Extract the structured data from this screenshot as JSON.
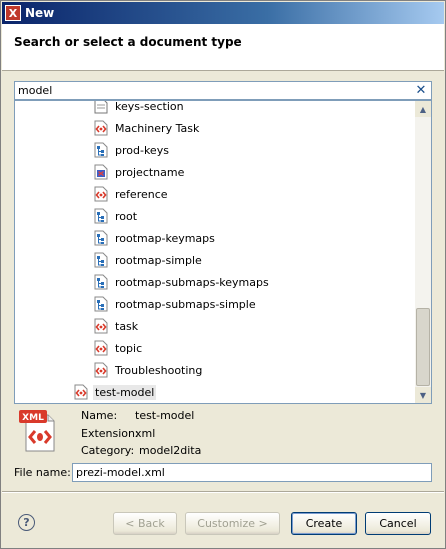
{
  "window": {
    "title": "New",
    "app_icon": "X"
  },
  "header": {
    "title": "Search or select a document type"
  },
  "search": {
    "value": "model"
  },
  "tree": {
    "items": [
      {
        "label": "keys-section",
        "icon": "document-icon"
      },
      {
        "label": "Machinery Task",
        "icon": "xml-red-icon"
      },
      {
        "label": "prod-keys",
        "icon": "map-icon"
      },
      {
        "label": "projectname",
        "icon": "project-icon"
      },
      {
        "label": "reference",
        "icon": "xml-red-icon"
      },
      {
        "label": "root",
        "icon": "map-icon"
      },
      {
        "label": "rootmap-keymaps",
        "icon": "map-icon"
      },
      {
        "label": "rootmap-simple",
        "icon": "map-icon"
      },
      {
        "label": "rootmap-submaps-keymaps",
        "icon": "map-icon"
      },
      {
        "label": "rootmap-submaps-simple",
        "icon": "map-icon"
      },
      {
        "label": "task",
        "icon": "xml-red-icon"
      },
      {
        "label": "topic",
        "icon": "xml-red-icon"
      },
      {
        "label": "Troubleshooting",
        "icon": "xml-red-icon"
      },
      {
        "label": "test-model",
        "icon": "xml-red-icon"
      }
    ]
  },
  "details": {
    "icon_text": "XML",
    "name_label": "Name:",
    "name_value": "test-model",
    "ext_label": "Extension:",
    "ext_value": "xml",
    "cat_label": "Category:",
    "cat_value": "model2dita"
  },
  "file_name": {
    "label": "File name:",
    "value": "prezi-model.xml"
  },
  "buttons": {
    "help": "?",
    "back": "< Back",
    "customize": "Customize >",
    "create": "Create",
    "cancel": "Cancel"
  },
  "colors": {
    "title_bar": "#0a246a",
    "accent_red": "#c0392b",
    "map_blue": "#2a6fb8"
  }
}
